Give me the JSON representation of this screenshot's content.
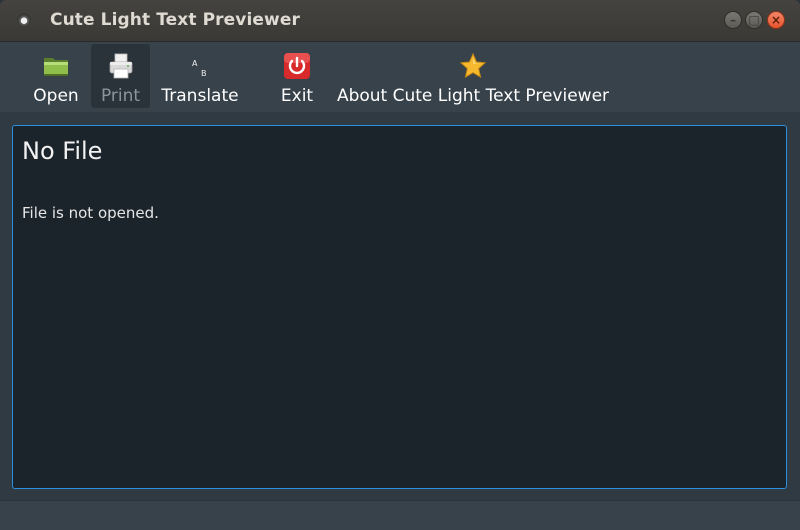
{
  "window": {
    "title": "Cute Light Text Previewer",
    "controls": {
      "minimize": "–",
      "maximize": "□",
      "close": "×"
    }
  },
  "toolbar": {
    "items": [
      {
        "label": "Open",
        "icon": "folder-icon",
        "enabled": true
      },
      {
        "label": "Print",
        "icon": "printer-icon",
        "enabled": false
      },
      {
        "label": "Translate",
        "icon": "translate-icon",
        "enabled": true
      },
      {
        "label": "Exit",
        "icon": "power-icon",
        "enabled": true
      },
      {
        "label": "About Cute Light Text Previewer",
        "icon": "star-icon",
        "enabled": true
      }
    ],
    "translate_glyphs": {
      "a": "A",
      "b": "B"
    }
  },
  "document": {
    "title": "No File",
    "body": "File is not opened."
  },
  "colors": {
    "accent_border": "#2d8fe0",
    "close_button": "#e4532c",
    "background": "#1b232b"
  }
}
